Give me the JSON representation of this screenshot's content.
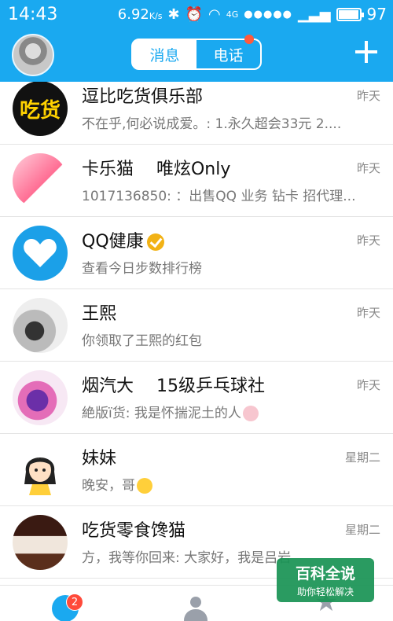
{
  "status_bar": {
    "time": "14:43",
    "net_speed": "6.92",
    "net_unit": "K/s",
    "network_type": "4G",
    "battery": "97"
  },
  "header": {
    "tab_messages": "消息",
    "tab_calls": "电话"
  },
  "conversations": [
    {
      "name": "逗比吃货俱乐部",
      "preview": "不在乎,何必说成爱。: 1.永久超会33元 2....",
      "time": "昨天",
      "avatar_text": "吃货"
    },
    {
      "name": "卡乐猫　 唯炫Only",
      "preview": "1017136850: ：出售QQ 业务 钻卡 招代理...",
      "time": "昨天"
    },
    {
      "name": "QQ健康",
      "preview": "查看今日步数排行榜",
      "time": "昨天"
    },
    {
      "name": "王熙",
      "preview": "你领取了王熙的红包",
      "time": "昨天"
    },
    {
      "name": "烟汽大　 15级乒乓球社",
      "preview": "絶版ï货: 我是怀揣泥土的人",
      "time": "昨天"
    },
    {
      "name": "妹妹",
      "preview": "晚安，哥",
      "time": "星期二"
    },
    {
      "name": "吃货零食馋猫",
      "preview": "方，我等你回来: 大家好，我是吕岩",
      "time": "星期二"
    }
  ],
  "tabbar": {
    "messages_badge": "2"
  },
  "watermark": {
    "title": "百科全说",
    "subtitle": "助你轻松解决"
  },
  "colors": {
    "header_blue": "#1aa9f0",
    "badge_red": "#ff4a3a",
    "verified_gold": "#f2b215"
  }
}
